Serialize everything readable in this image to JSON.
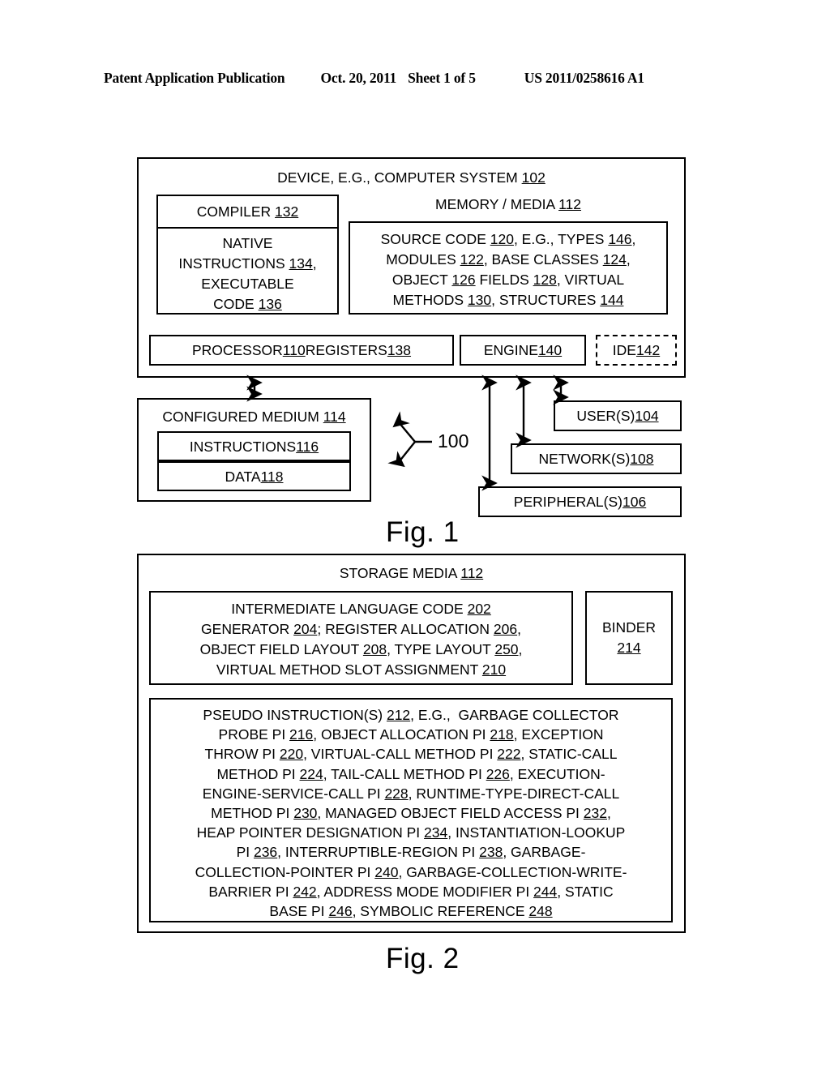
{
  "header": {
    "publication": "Patent Application Publication",
    "date": "Oct. 20, 2011",
    "sheet": "Sheet 1 of 5",
    "document_number": "US 2011/0258616 A1"
  },
  "figures": [
    {
      "caption": "Fig. 1"
    },
    {
      "caption": "Fig. 2"
    }
  ],
  "fig1": {
    "device_title": "DEVICE, E.G., COMPUTER SYSTEM ",
    "device_ref": "102",
    "compiler": {
      "title": "COMPILER ",
      "title_ref": "132",
      "body_lines": [
        "NATIVE",
        "INSTRUCTIONS 134,",
        "EXECUTABLE",
        "CODE 136"
      ],
      "body_refs": [
        "134",
        "136"
      ]
    },
    "memory": {
      "title": "MEMORY / MEDIA ",
      "title_ref": "112",
      "source_lines": [
        "SOURCE CODE 120, E.G., TYPES 146,",
        "MODULES 122, BASE CLASSES 124,",
        "OBJECT 126 FIELDS 128, VIRTUAL",
        "METHODS 130, STRUCTURES 144"
      ],
      "source_refs": [
        "120",
        "146",
        "122",
        "124",
        "126",
        "128",
        "130",
        "144"
      ]
    },
    "processor": {
      "label_a": "PROCESSOR ",
      "ref_a": "110",
      "label_b": " REGISTERS ",
      "ref_b": "138"
    },
    "engine": {
      "label": "ENGINE ",
      "ref": "140"
    },
    "ide": {
      "label": "IDE ",
      "ref": "142"
    },
    "configured_medium": {
      "label": "CONFIGURED MEDIUM ",
      "ref": "114"
    },
    "instructions": {
      "label": "INSTRUCTIONS ",
      "ref": "116"
    },
    "data": {
      "label": "DATA ",
      "ref": "118"
    },
    "users": {
      "label": "USER(S) ",
      "ref": "104"
    },
    "networks": {
      "label": "NETWORK(S) ",
      "ref": "108"
    },
    "peripherals": {
      "label": "PERIPHERAL(S) ",
      "ref": "106"
    },
    "callout": "100"
  },
  "fig2": {
    "storage_title": "STORAGE MEDIA ",
    "storage_ref": "112",
    "il_code_lines": [
      "INTERMEDIATE LANGUAGE CODE 202",
      "GENERATOR 204; REGISTER ALLOCATION 206,",
      "OBJECT FIELD LAYOUT 208, TYPE LAYOUT 250,",
      "VIRTUAL METHOD SLOT ASSIGNMENT 210"
    ],
    "il_code_refs": [
      "202",
      "204",
      "206",
      "208",
      "250",
      "210"
    ],
    "binder": {
      "label": "BINDER",
      "ref": "214"
    },
    "pseudo_lines": [
      "PSEUDO INSTRUCTION(S) 212, E.G.,  GARBAGE COLLECTOR",
      "PROBE PI 216, OBJECT ALLOCATION PI 218, EXCEPTION",
      "THROW PI 220, VIRTUAL-CALL METHOD PI 222, STATIC-CALL",
      "METHOD PI 224, TAIL-CALL METHOD PI 226, EXECUTION-",
      "ENGINE-SERVICE-CALL PI 228, RUNTIME-TYPE-DIRECT-CALL",
      "METHOD PI 230, MANAGED OBJECT FIELD ACCESS PI 232,",
      "HEAP POINTER DESIGNATION PI 234, INSTANTIATION-LOOKUP",
      "PI 236, INTERRUPTIBLE-REGION PI 238, GARBAGE-",
      "COLLECTION-POINTER PI 240, GARBAGE-COLLECTION-WRITE-",
      "BARRIER PI 242, ADDRESS MODE MODIFIER PI 244, STATIC",
      "BASE PI 246, SYMBOLIC REFERENCE 248"
    ],
    "pseudo_refs": [
      "212",
      "216",
      "218",
      "220",
      "222",
      "224",
      "226",
      "228",
      "230",
      "232",
      "234",
      "236",
      "238",
      "240",
      "242",
      "244",
      "246",
      "248"
    ]
  },
  "colors": {
    "ink": "#000000",
    "paper": "#ffffff"
  }
}
